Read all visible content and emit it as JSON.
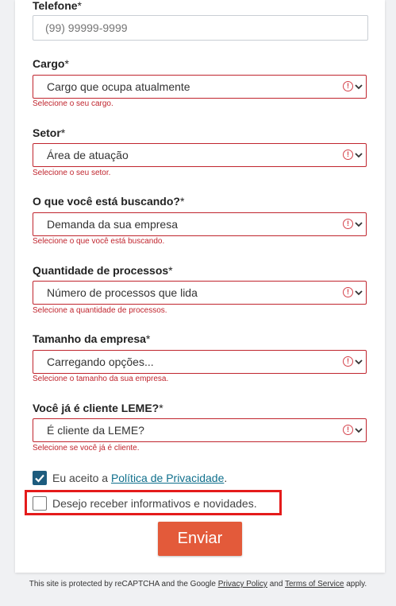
{
  "form": {
    "phone": {
      "label": "Telefone",
      "required_mark": "*",
      "placeholder": "(99) 99999-9999"
    },
    "fields": [
      {
        "label": "Cargo",
        "required_mark": "*",
        "value": "Cargo que ocupa atualmente",
        "error": "Selecione o seu cargo."
      },
      {
        "label": "Setor",
        "required_mark": "*",
        "value": "Área de atuação",
        "error": "Selecione o seu setor."
      },
      {
        "label": "O que você está buscando?",
        "required_mark": "*",
        "value": "Demanda da sua empresa",
        "error": "Selecione o que você está buscando."
      },
      {
        "label": "Quantidade de processos",
        "required_mark": "*",
        "value": "Número de processos que lida",
        "error": "Selecione a quantidade de processos."
      },
      {
        "label": "Tamanho da empresa",
        "required_mark": "*",
        "value": "Carregando opções...",
        "error": "Selecione o tamanho da sua empresa."
      },
      {
        "label": "Você já é cliente LEME?",
        "required_mark": "*",
        "value": "É cliente da LEME?",
        "error": "Selecione se você já é cliente."
      }
    ],
    "privacy": {
      "prefix": "Eu aceito a ",
      "link": "Política de Privacidade",
      "suffix": ".",
      "checked": true
    },
    "newsletter": {
      "label": "Desejo receber informativos e novidades.",
      "checked": false
    },
    "submit_label": "Enviar",
    "error_icon_glyph": "!"
  },
  "footer": {
    "text1": "This site is protected by reCAPTCHA and the Google ",
    "privacy_link": "Privacy Policy",
    "text2": " and ",
    "terms_link": "Terms of Service",
    "text3": " apply."
  },
  "colors": {
    "error": "#c0252e",
    "checkbox_checked": "#1d5c7e",
    "submit_bg": "#e35a3a",
    "link": "#0f6f8c",
    "highlight_box": "#e41b1b"
  }
}
